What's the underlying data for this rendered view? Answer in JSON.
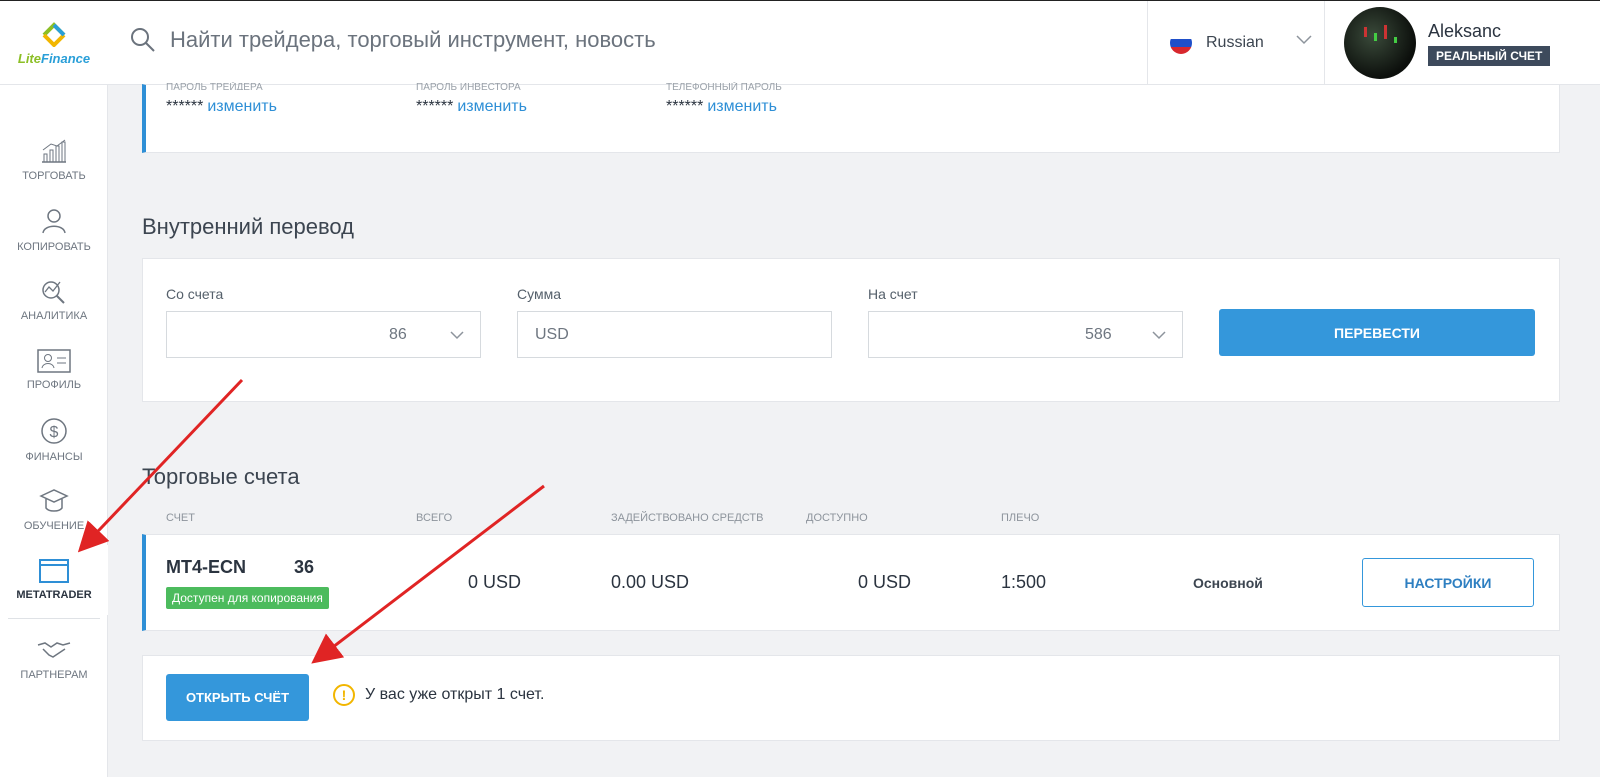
{
  "header": {
    "brand_lite": "Lite",
    "brand_finance": "Finance",
    "search_placeholder": "Найти трейдера, торговый инструмент, новость",
    "language": "Russian",
    "user_name": "Aleksanc",
    "account_badge": "РЕАЛЬНЫЙ СЧЕТ"
  },
  "sidebar": {
    "items": [
      {
        "label": "ТОРГОВАТЬ",
        "icon": "chart-icon"
      },
      {
        "label": "КОПИРОВАТЬ",
        "icon": "user-copy-icon"
      },
      {
        "label": "АНАЛИТИКА",
        "icon": "analytics-icon"
      },
      {
        "label": "ПРОФИЛЬ",
        "icon": "profile-card-icon"
      },
      {
        "label": "ФИНАНСЫ",
        "icon": "dollar-icon"
      },
      {
        "label": "ОБУЧЕНИЕ",
        "icon": "graduation-cap-icon"
      },
      {
        "label": "METATRADER",
        "icon": "window-icon"
      },
      {
        "label": "ПАРТНЕРАМ",
        "icon": "handshake-icon"
      }
    ]
  },
  "passwords": {
    "labels": [
      "ПАРОЛЬ ТРЕЙДЕРА",
      "ПАРОЛЬ ИНВЕСТОРА",
      "ТЕЛЕФОННЫЙ ПАРОЛЬ"
    ],
    "masked": "******",
    "change_link": "изменить"
  },
  "transfer": {
    "title": "Внутренний перевод",
    "from_label": "Со счета",
    "from_value": "86",
    "amount_label": "Сумма",
    "amount_placeholder": "USD",
    "to_label": "На счет",
    "to_value": "586",
    "submit": "ПЕРЕВЕСТИ"
  },
  "accounts": {
    "title": "Торговые счета",
    "columns": [
      "СЧЕТ",
      "ВСЕГО",
      "ЗАДЕЙСТВОВАНО СРЕДСТВ",
      "ДОСТУПНО",
      "ПЛЕЧО"
    ],
    "row": {
      "name": "MT4-ECN",
      "name_suffix": "36",
      "copy_badge": "Доступен для копирования",
      "total": "0 USD",
      "used": "0.00 USD",
      "available": "0 USD",
      "leverage": "1:500",
      "type": "Основной",
      "settings": "НАСТРОЙКИ"
    },
    "open_button": "ОТКРЫТЬ СЧЁТ",
    "notice": "У вас уже открыт 1 счет."
  },
  "colors": {
    "accent": "#3497db",
    "badge_green": "#4cbb5d",
    "warning": "#f2b600",
    "annotation_arrow": "#e02424"
  }
}
